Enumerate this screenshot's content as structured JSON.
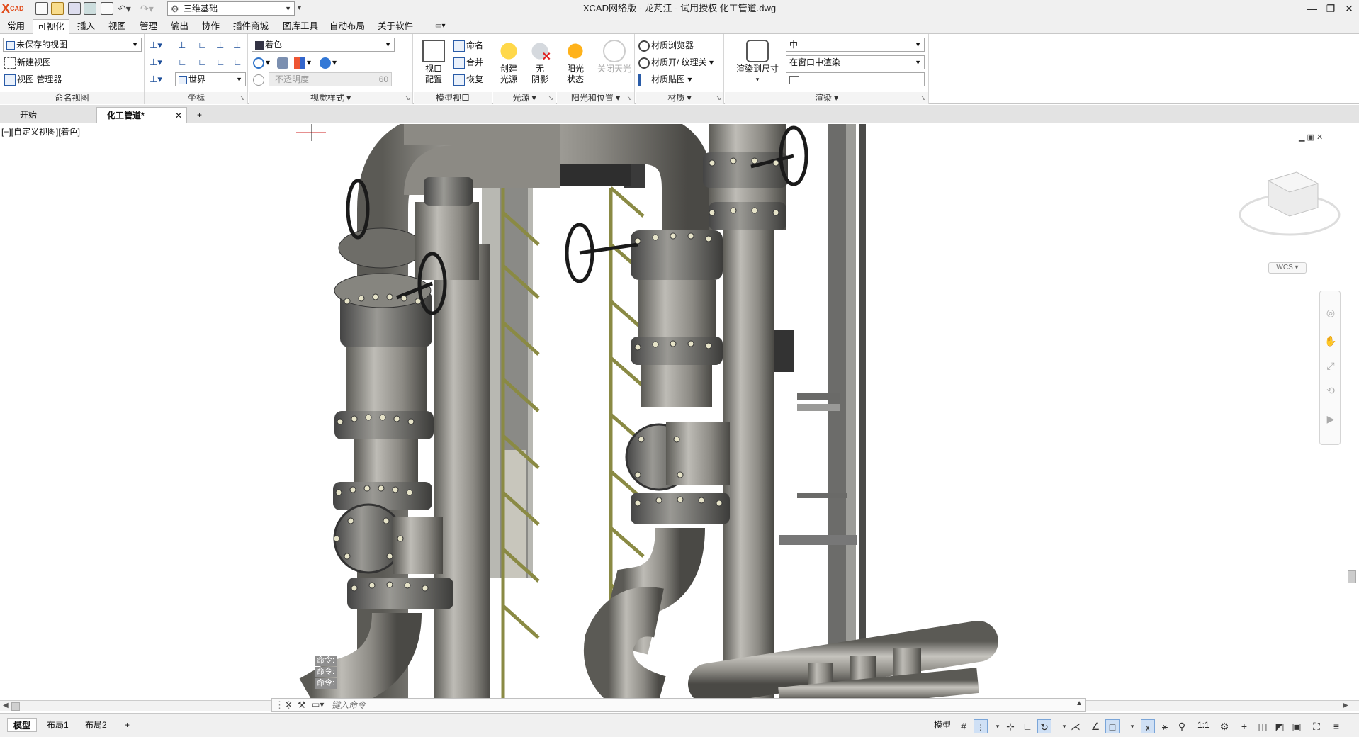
{
  "app": {
    "logo": "X",
    "logo_sup": "CAD",
    "title": "XCAD网络版 - 龙芃江 - 试用授权     化工管道.dwg"
  },
  "quick": {
    "workspace": "三维基础"
  },
  "menu": {
    "tabs": [
      "常用",
      "可视化",
      "插入",
      "视图",
      "管理",
      "输出",
      "协作",
      "插件商城",
      "图库工具",
      "自动布局",
      "关于软件"
    ]
  },
  "ribbon": {
    "named_views": {
      "combo": "未保存的视图",
      "new_view": "新建视图",
      "view_manager": "视图 管理器",
      "title": "命名视图"
    },
    "coords": {
      "combo": "世界",
      "title": "坐标"
    },
    "visual_style": {
      "combo": "着色",
      "opacity_label": "不透明度",
      "opacity_value": "60",
      "title": "视觉样式"
    },
    "model_viewport": {
      "config1": "视口",
      "config2": "配置",
      "name": "命名",
      "merge": "合并",
      "restore": "恢复",
      "title": "模型视口"
    },
    "lights": {
      "create1": "创建",
      "create2": "光源",
      "shadow1": "无",
      "shadow2": "阴影",
      "title": "光源"
    },
    "sun": {
      "status1": "阳光",
      "status2": "状态",
      "sky": "关闭天光",
      "title": "阳光和位置"
    },
    "materials": {
      "browser": "材质浏览器",
      "texture": "材质开/ 纹理关",
      "mapping": "材质贴图",
      "title": "材质"
    },
    "render": {
      "render_size": "渲染到尺寸",
      "quality": "中",
      "target": "在窗口中渲染",
      "title": "渲染"
    }
  },
  "doc_tabs": {
    "start": "开始",
    "active": "化工管道*",
    "close": "✕",
    "add": "+"
  },
  "viewport": {
    "label": "[−][自定义视图][着色]",
    "wcs": "WCS",
    "cmd_history": [
      "命令:",
      "命令:",
      "命令:"
    ]
  },
  "command": {
    "placeholder": "键入命令"
  },
  "layouts": {
    "tabs": [
      "模型",
      "布局1",
      "布局2"
    ],
    "add": "+"
  },
  "status": {
    "model": "模型",
    "scale": "1:1"
  },
  "colors": {
    "pipe": "#8c8a84",
    "pipe_light": "#bebcb6",
    "pipe_dark": "#5b5a55",
    "ladder": "#8a8a44",
    "flange_bolt": "#e6e3c8",
    "steel": "#6a6a6a"
  }
}
